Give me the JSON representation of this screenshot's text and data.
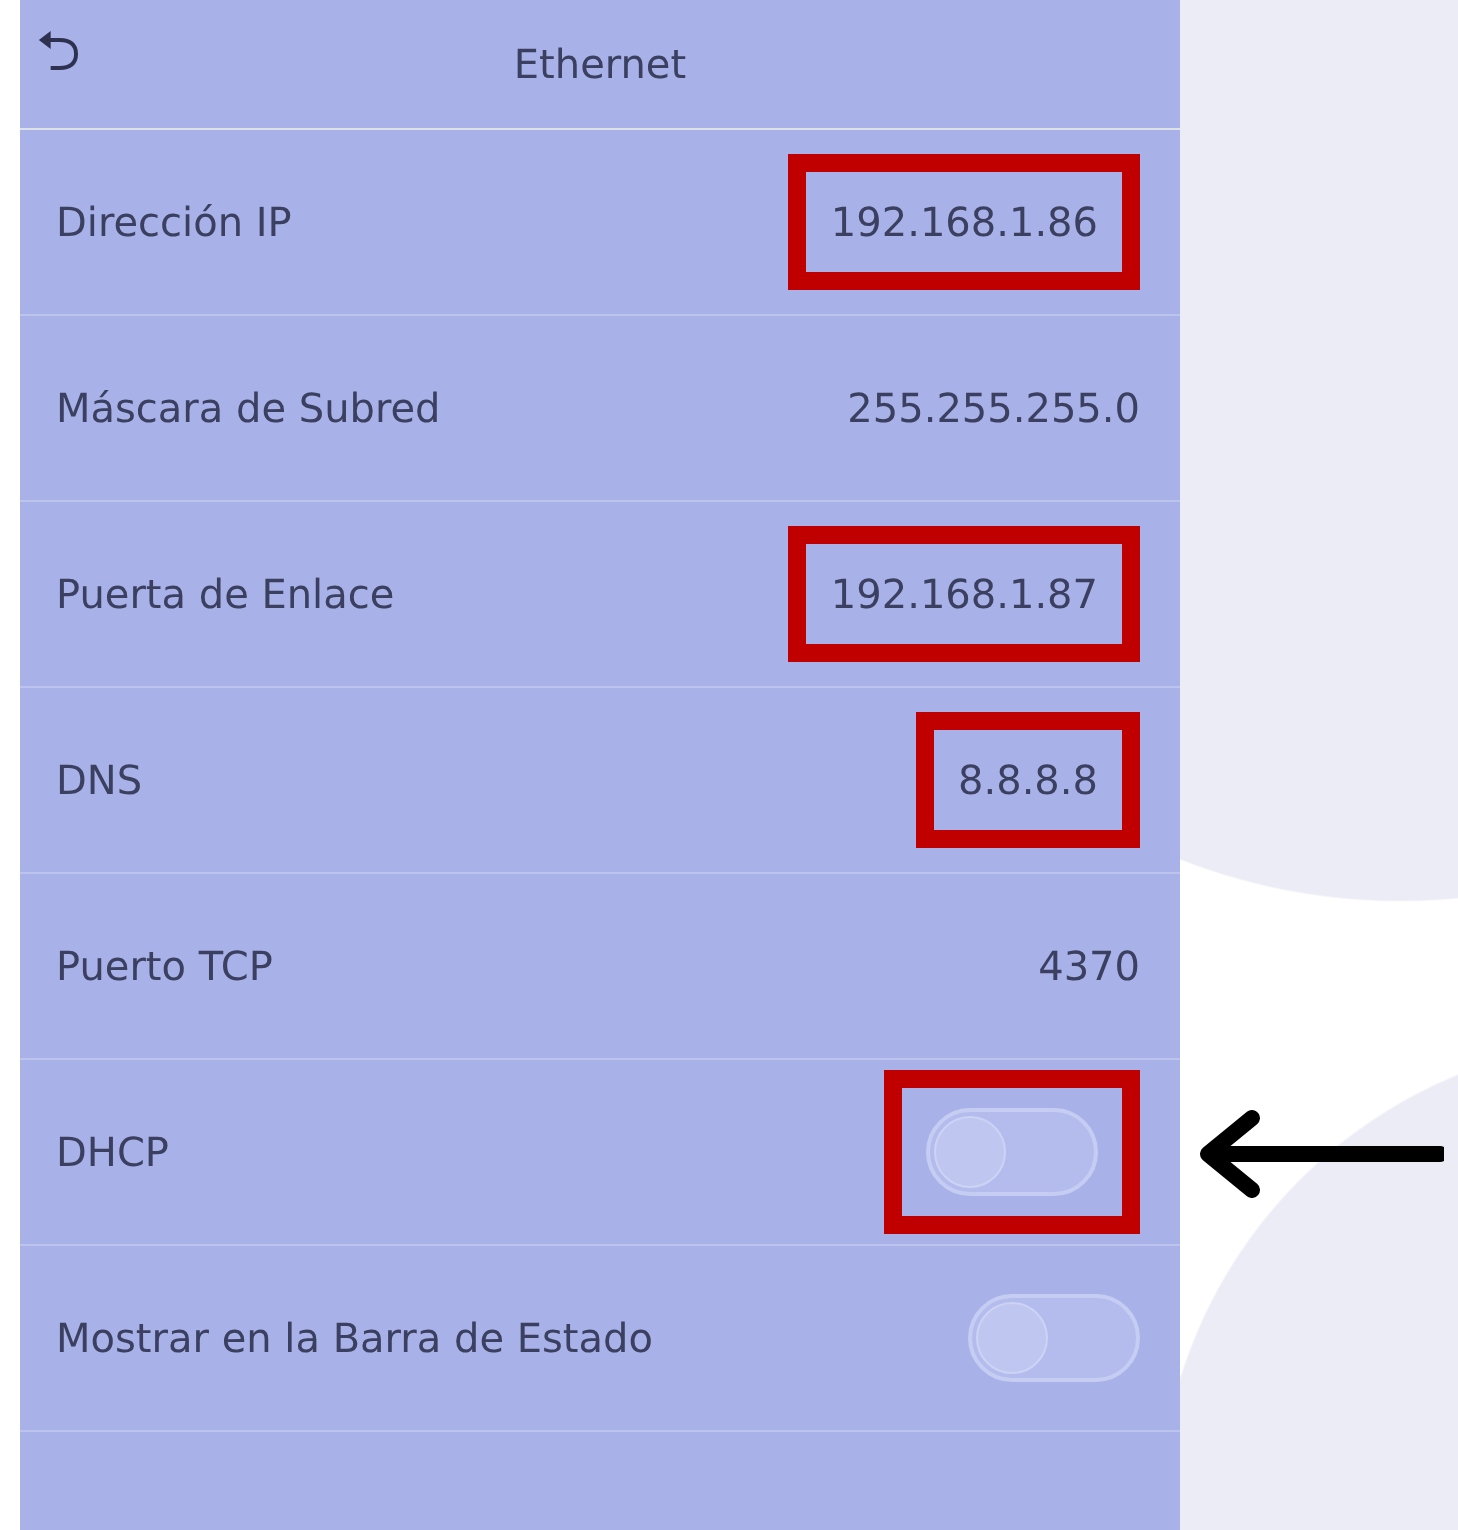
{
  "header": {
    "back": "⮌",
    "title": "Ethernet"
  },
  "rows": [
    {
      "kind": "value",
      "label": "Dirección IP",
      "value": "192.168.1.86",
      "highlighted": true,
      "arrow": false
    },
    {
      "kind": "value",
      "label": "Máscara de Subred",
      "value": "255.255.255.0",
      "highlighted": false,
      "arrow": false
    },
    {
      "kind": "value",
      "label": "Puerta de Enlace",
      "value": "192.168.1.87",
      "highlighted": true,
      "arrow": false
    },
    {
      "kind": "value",
      "label": "DNS",
      "value": "8.8.8.8",
      "highlighted": true,
      "arrow": false
    },
    {
      "kind": "value",
      "label": "Puerto TCP",
      "value": "4370",
      "highlighted": false,
      "arrow": false
    },
    {
      "kind": "toggle",
      "label": "DHCP",
      "on": false,
      "highlighted": true,
      "arrow": true
    },
    {
      "kind": "toggle",
      "label": "Mostrar en la Barra de Estado",
      "on": false,
      "highlighted": false,
      "arrow": false
    }
  ]
}
